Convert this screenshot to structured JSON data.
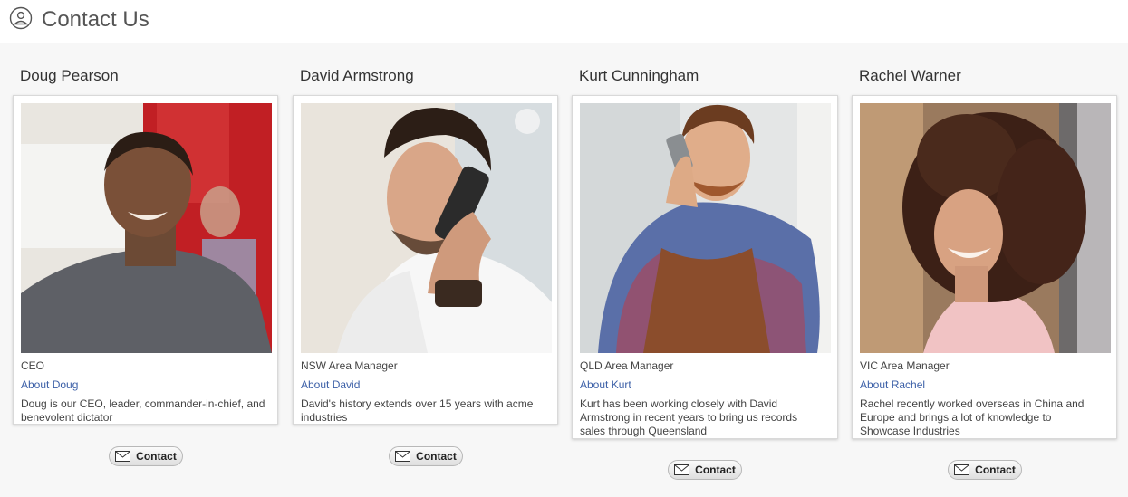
{
  "header": {
    "title": "Contact Us",
    "icon": "user-circle-icon"
  },
  "people": [
    {
      "name": "Doug Pearson",
      "role": "CEO",
      "about": "About Doug",
      "bio": "Doug is our CEO, leader, commander-in-chief, and benevolent dictator",
      "contact": "Contact"
    },
    {
      "name": "David Armstrong",
      "role": "NSW Area Manager",
      "about": "About David",
      "bio": "David's history extends over 15 years with acme industries",
      "contact": "Contact"
    },
    {
      "name": "Kurt Cunningham",
      "role": "QLD Area Manager",
      "about": "About Kurt",
      "bio": "Kurt has been working closely with David Armstrong in recent years to bring us records sales through Queensland",
      "contact": "Contact"
    },
    {
      "name": "Rachel Warner",
      "role": "VIC Area Manager",
      "about": "About Rachel",
      "bio": "Rachel recently worked overseas in China and Europe and brings a lot of knowledge to Showcase Industries",
      "contact": "Contact"
    }
  ],
  "colors": {
    "link": "#3b5fa7",
    "header_bg": "#ffffff",
    "page_bg": "#f7f7f7"
  }
}
